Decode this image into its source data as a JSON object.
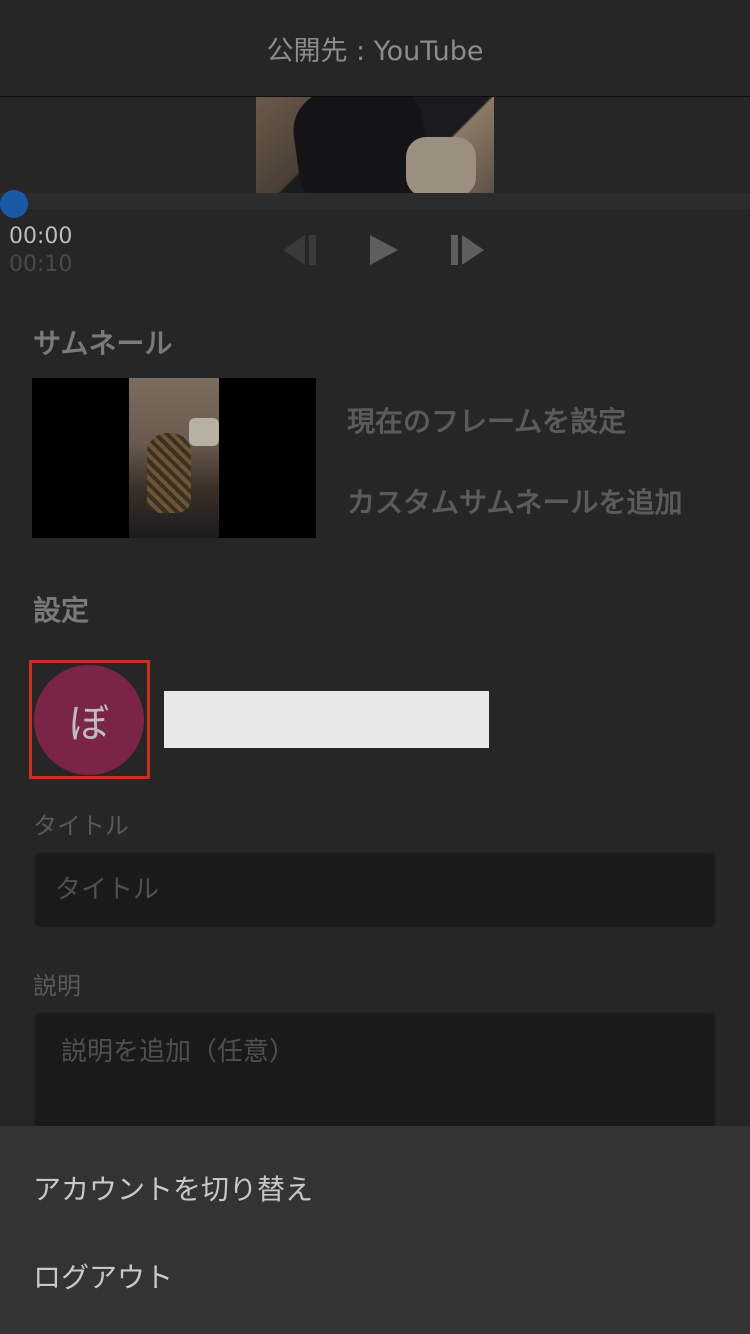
{
  "header": {
    "title": "公開先 : YouTube"
  },
  "player": {
    "current_time": "00:00",
    "total_time": "00:10",
    "progress": 0
  },
  "thumbnail": {
    "heading": "サムネール",
    "set_current_frame": "現在のフレームを設定",
    "add_custom": "カスタムサムネールを追加"
  },
  "settings": {
    "heading": "設定",
    "avatar_initial": "ぼ",
    "title_label": "タイトル",
    "title_placeholder": "タイトル",
    "description_label": "説明",
    "description_placeholder": "説明を追加（任意）"
  },
  "sheet": {
    "items": [
      {
        "label": "アカウントを切り替え"
      },
      {
        "label": "ログアウト"
      }
    ]
  },
  "colors": {
    "accent": "#1a5aa5",
    "avatar_bg": "#7a2447",
    "highlight": "#c6321f"
  }
}
